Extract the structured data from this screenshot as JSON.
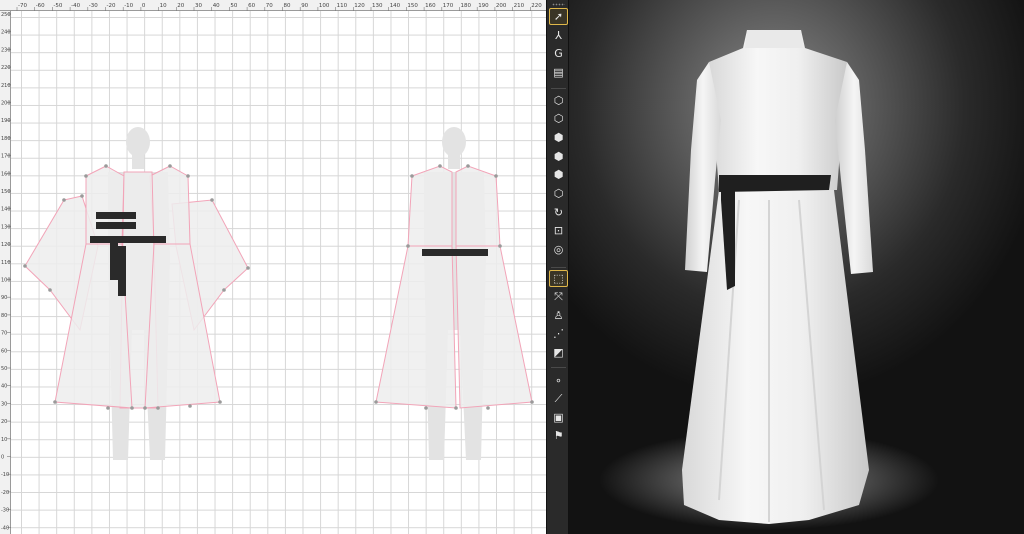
{
  "ruler": {
    "top_ticks": [
      "-70",
      "-60",
      "-50",
      "-40",
      "-30",
      "-20",
      "-10",
      "0",
      "10",
      "20",
      "30",
      "40",
      "50",
      "60",
      "70",
      "80",
      "90",
      "100",
      "110",
      "120",
      "130",
      "140",
      "150",
      "160",
      "170",
      "180",
      "190",
      "200",
      "210",
      "220"
    ],
    "left_ticks": [
      "250",
      "240",
      "230",
      "220",
      "210",
      "200",
      "190",
      "180",
      "170",
      "160",
      "150",
      "140",
      "130",
      "120",
      "110",
      "100",
      "90",
      "80",
      "70",
      "60",
      "50",
      "40",
      "30",
      "20",
      "10",
      "0",
      "-10",
      "-20",
      "-30",
      "-40"
    ]
  },
  "toolbar": {
    "tools": [
      {
        "name": "select-move-icon",
        "glyph": "➚",
        "active": true
      },
      {
        "name": "transform-pattern-icon",
        "glyph": "⅄",
        "active": false
      },
      {
        "name": "rotate-3d-icon",
        "glyph": "G",
        "active": false
      },
      {
        "name": "fold-arrangement-icon",
        "glyph": "▤",
        "active": false
      },
      {
        "name": "arrangement-point-icon",
        "glyph": "⬡",
        "active": false
      },
      {
        "name": "cube-front-icon",
        "glyph": "⬡",
        "active": false
      },
      {
        "name": "cube-back-icon",
        "glyph": "⬢",
        "active": false
      },
      {
        "name": "cube-left-icon",
        "glyph": "⬢",
        "active": false
      },
      {
        "name": "cube-right-icon",
        "glyph": "⬢",
        "active": false
      },
      {
        "name": "cube-top-icon",
        "glyph": "⬡",
        "active": false
      },
      {
        "name": "orbit-icon",
        "glyph": "↻",
        "active": false
      },
      {
        "name": "fit-view-icon",
        "glyph": "⊡",
        "active": false
      },
      {
        "name": "snapshot-icon",
        "glyph": "◎",
        "active": false
      },
      {
        "name": "select-mesh-icon",
        "glyph": "⬚",
        "active": true
      },
      {
        "name": "transform-mesh-icon",
        "glyph": "⤧",
        "active": false
      },
      {
        "name": "pin-avatar-icon",
        "glyph": "♙",
        "active": false
      },
      {
        "name": "tack-icon",
        "glyph": "⋰",
        "active": false
      },
      {
        "name": "fold-corner-icon",
        "glyph": "◩",
        "active": false
      },
      {
        "name": "point-set-icon",
        "glyph": "∘",
        "active": false
      },
      {
        "name": "line-set-icon",
        "glyph": "⟋",
        "active": false
      },
      {
        "name": "pin-set-icon",
        "glyph": "▣",
        "active": false
      },
      {
        "name": "flag-set-icon",
        "glyph": "⚑",
        "active": false
      }
    ]
  },
  "colors": {
    "seam_pink": "#f2a4b8",
    "pattern_fill": "#efefef",
    "avatar_silhouette": "#e2e2e2",
    "belt": "#2a2a2a",
    "accent": "#e0b84a",
    "garment_white": "#f4f4f4"
  }
}
